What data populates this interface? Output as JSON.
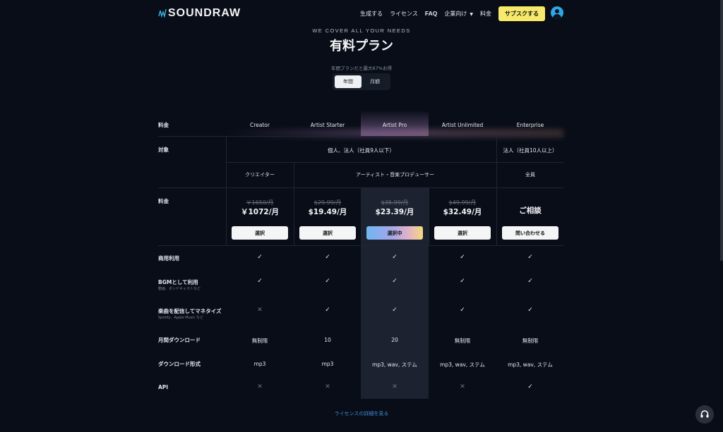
{
  "brand": "SOUNDRAW",
  "nav": {
    "items": [
      "生成する",
      "ライセンス",
      "FAQ",
      "企業向け",
      "料金"
    ],
    "subscribe": "サブスクする"
  },
  "hero": {
    "kicker": "WE COVER ALL YOUR NEEDS",
    "title": "有料プラン",
    "note": "年間プランだと最大67%お得",
    "toggle": [
      "年間",
      "月額"
    ],
    "toggle_active": "年間"
  },
  "plans": [
    "Creator",
    "Artist Starter",
    "Artist Pro",
    "Artist Unlimited",
    "Enterprise"
  ],
  "rows": {
    "price_label": "料金",
    "target_label": "対象",
    "commercial": "商用利用",
    "bgm": "BGMとして利用",
    "bgm_sub": "動画、ポッドキャストなど",
    "distribute": "楽曲を配信してマネタイズ",
    "distribute_sub": "Spotify、Apple Music など",
    "downloads": "月間ダウンロード",
    "format": "ダウンロード形式",
    "api": "API"
  },
  "target": {
    "individual": "個人、法人（社員9人以下）",
    "corporate": "法人（社員10人以上）",
    "creator": "クリエイター",
    "artist": "アーティスト・音楽プロデューサー",
    "all": "全員"
  },
  "prices": {
    "creator_old": "￥1650/月",
    "creator": "￥1072/月",
    "starter_old": "$29.99/月",
    "starter": "$19.49/月",
    "pro_old": "$35.99/月",
    "pro": "$23.39/月",
    "unlimited_old": "$49.99/月",
    "unlimited": "$32.49/月",
    "enterprise": "ご相談"
  },
  "buttons": {
    "select": "選択",
    "selected": "選択中",
    "contact": "問い合わせる"
  },
  "downloads": [
    "無制限",
    "10",
    "20",
    "無制限",
    "無制限"
  ],
  "formats": [
    "mp3",
    "mp3",
    "mp3, wav, ステム",
    "mp3, wav, ステム",
    "mp3, wav, ステム"
  ],
  "features": {
    "commercial": [
      true,
      true,
      true,
      true,
      true
    ],
    "bgm": [
      true,
      true,
      true,
      true,
      true
    ],
    "distribute": [
      false,
      true,
      true,
      true,
      true
    ],
    "api": [
      false,
      false,
      false,
      false,
      true
    ]
  },
  "footer_link": "ライセンスの詳細を見る",
  "colors": {
    "accent": "#f6e96b",
    "link": "#3f8de0",
    "avatar": "#2fa6e6"
  }
}
